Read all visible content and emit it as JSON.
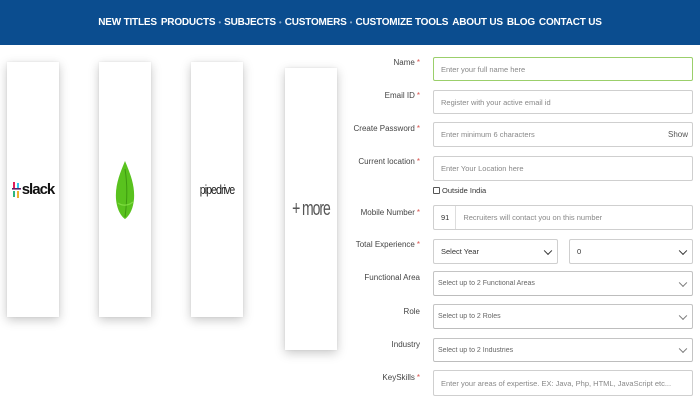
{
  "nav": {
    "items": [
      "NEW TITLES",
      "PRODUCTS",
      "SUBJECTS",
      "CUSTOMERS",
      "CUSTOMIZE TOOLS",
      "ABOUT US",
      "BLOG",
      "CONTACT US"
    ],
    "separator": "•"
  },
  "partners": {
    "slack": "slack",
    "pipedrive": "pipedrive",
    "more": "+ more"
  },
  "form": {
    "name": {
      "label": "Name",
      "required": "*",
      "placeholder": "Enter your full name here"
    },
    "email": {
      "label": "Email ID",
      "required": "*",
      "placeholder": "Register with your active email id"
    },
    "password": {
      "label": "Create Password",
      "required": "*",
      "placeholder": "Enter minimum 6 characters",
      "show": "Show"
    },
    "location": {
      "label": "Current location",
      "required": "*",
      "placeholder": "Enter Your Location here"
    },
    "outside": {
      "label": "Outside India"
    },
    "mobile": {
      "label": "Mobile Number",
      "required": "*",
      "country_code": "91",
      "placeholder": "Recruiters will contact you on this number"
    },
    "experience": {
      "label": "Total Experience",
      "required": "*",
      "year": "Select Year",
      "month": "0"
    },
    "functional": {
      "label": "Functional Area",
      "placeholder": "Select up to 2 Functional Areas"
    },
    "role": {
      "label": "Role",
      "placeholder": "Select up to 2 Roles"
    },
    "industry": {
      "label": "Industry",
      "placeholder": "Select up to 2 Industries"
    },
    "keyskills": {
      "label": "KeySkills",
      "required": "*",
      "placeholder": "Enter your areas of expertise. EX: Java, Php, HTML, JavaScript etc..."
    }
  },
  "colors": {
    "nav_bg": "#0b4d8f",
    "required": "#d9534f",
    "active_border": "#9bcf6b",
    "sprout_green": "#59c21e"
  }
}
